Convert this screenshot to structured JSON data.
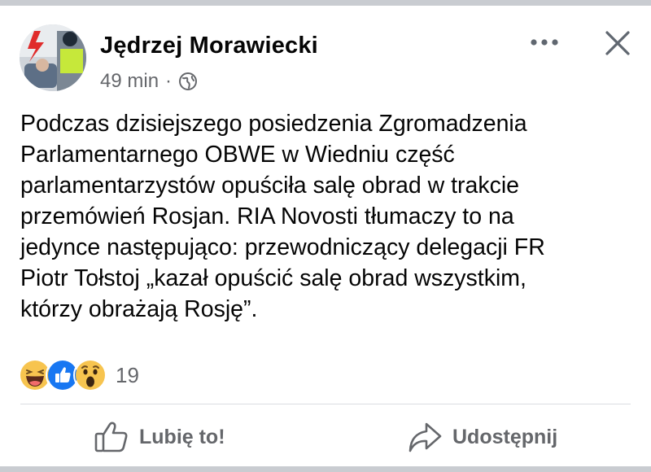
{
  "post": {
    "author": "Jędrzej Morawiecki",
    "time": "49 min",
    "separator": "·",
    "privacy_icon": "globe-icon",
    "text": "Podczas dzisiejszego posiedzenia Zgromadzenia\nParlamentarnego OBWE w Wiedniu część\nparlamentarzystów opuściła salę obrad w trakcie\nprzemówień Rosjan. RIA Novosti tłumaczy to na\njedynce następująco: przewodniczący delegacji FR\nPiotr Tołstoj „kazał opuścić salę obrad wszystkim,\nktórzy obrażają Rosję”."
  },
  "header": {
    "more_icon": "more-dots-icon",
    "close_icon": "close-icon"
  },
  "reactions": {
    "icons": [
      "haha-icon",
      "like-icon",
      "wow-icon"
    ],
    "count": "19"
  },
  "actions": {
    "like_label": "Lubię to!",
    "share_label": "Udostępnij"
  },
  "colors": {
    "secondary_text": "#65676b",
    "like_blue": "#1877f2",
    "reaction_yellow": "#f7c44f",
    "divider": "#dadde1"
  }
}
